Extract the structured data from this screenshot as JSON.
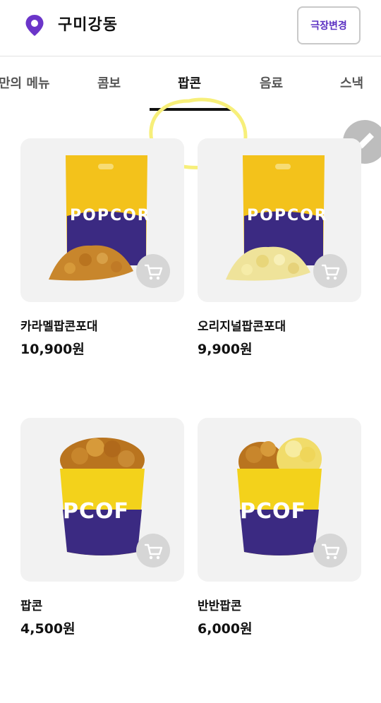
{
  "header": {
    "location_icon": "map-pin-icon",
    "theater_name": "구미강동",
    "change_theater_label": "극장변경"
  },
  "tabs": [
    {
      "label": "만의 메뉴",
      "active": false
    },
    {
      "label": "콤보",
      "active": false
    },
    {
      "label": "팝콘",
      "active": true
    },
    {
      "label": "음료",
      "active": false
    },
    {
      "label": "스낵",
      "active": false
    }
  ],
  "fab": {
    "icon": "pencil-icon"
  },
  "products": [
    {
      "name": "카라멜팝콘포대",
      "price": "10,900원",
      "image": "caramel-popcorn-bag",
      "cart_icon": "cart-icon"
    },
    {
      "name": "오리지널팝콘포대",
      "price": "9,900원",
      "image": "original-popcorn-bag",
      "cart_icon": "cart-icon"
    },
    {
      "name": "팝콘",
      "price": "4,500원",
      "image": "popcorn-bucket",
      "cart_icon": "cart-icon"
    },
    {
      "name": "반반팝콘",
      "price": "6,000원",
      "image": "half-half-popcorn-bucket",
      "cart_icon": "cart-icon"
    }
  ],
  "colors": {
    "accent": "#5a2fc2",
    "pin": "#6b35c9",
    "bag_yellow": "#f3c21b",
    "bag_purple": "#3b2a82",
    "highlight": "#f7ef7a"
  }
}
